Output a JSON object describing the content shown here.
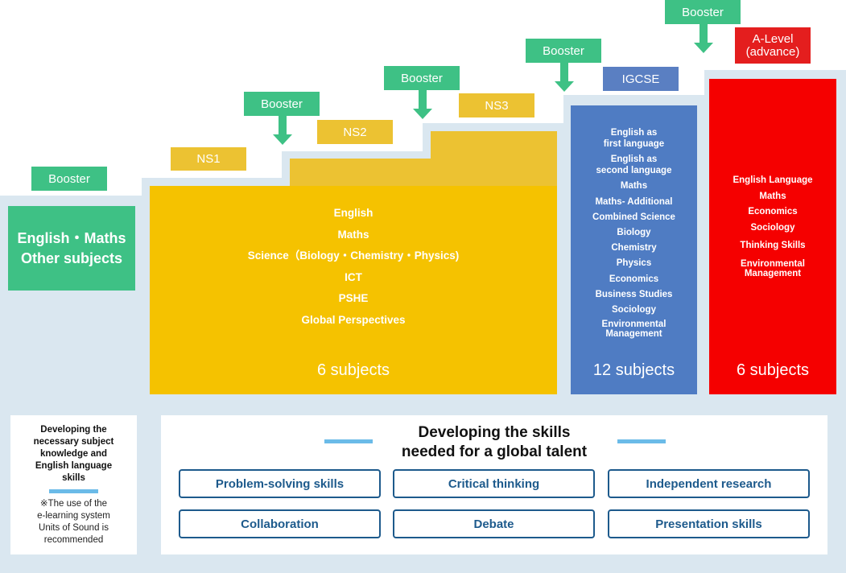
{
  "stages": {
    "pre": {
      "booster": "Booster",
      "content": [
        "English・Maths",
        "Other subjects"
      ]
    },
    "ns1": {
      "label": "NS1"
    },
    "ns2": {
      "label": "NS2",
      "booster": "Booster"
    },
    "ns3": {
      "label": "NS3",
      "booster": "Booster"
    },
    "igcse": {
      "label": "IGCSE",
      "booster": "Booster"
    },
    "alevel": {
      "label_line1": "A-Level",
      "label_line2": "(advance)",
      "booster": "Booster"
    }
  },
  "ns_block": {
    "subjects": [
      "English",
      "Maths",
      "Science（Biology・Chemistry・Physics)",
      "ICT",
      "PSHE",
      "Global Perspectives"
    ],
    "count": "6 subjects"
  },
  "igcse_block": {
    "subjects": [
      "English as",
      "first language",
      "English as",
      "second language",
      "Maths",
      "Maths- Additional",
      "Combined Science",
      "Biology",
      "Chemistry",
      "Physics",
      "Economics",
      "Business Studies",
      "Sociology",
      "Environmental",
      "Management"
    ],
    "count": "12 subjects"
  },
  "alevel_block": {
    "subjects": [
      "English Language",
      "Maths",
      "Economics",
      "Sociology",
      "Thinking Skills",
      "Environmental",
      "Management"
    ],
    "count": "6 subjects"
  },
  "left_note": {
    "title_lines": [
      "Developing the",
      "necessary subject",
      "knowledge and",
      "English language",
      "skills"
    ],
    "note_lines": [
      "※The use of the",
      "e-learning system",
      "Units of Sound is",
      "recommended"
    ]
  },
  "skills_panel": {
    "title_line1": "Developing the skills",
    "title_line2": "needed for a global talent",
    "skills": [
      "Problem-solving skills",
      "Critical thinking",
      "Independent research",
      "Collaboration",
      "Debate",
      "Presentation skills"
    ]
  },
  "colors": {
    "booster_green": "#3ec185",
    "ns_yellow": "#f5c200",
    "ns_label_yellow": "#ecc232",
    "igcse_blue": "#4f7cc3",
    "alevel_red": "#f50000",
    "skill_border": "#1d5a8c",
    "background_blue": "#dae7f0"
  }
}
